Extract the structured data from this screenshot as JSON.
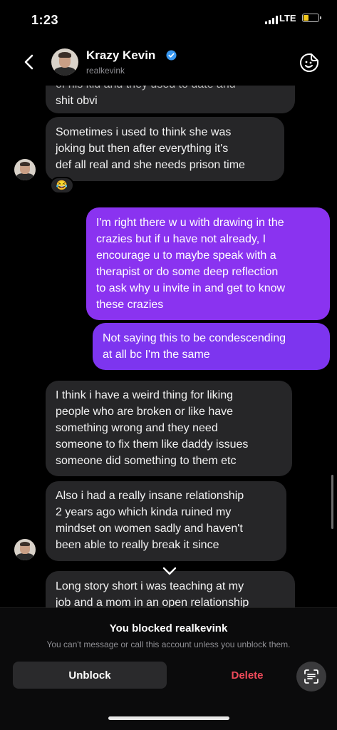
{
  "status_bar": {
    "time": "1:23",
    "network": "LTE",
    "battery_level": 0.25,
    "battery_color": "#f2c81e"
  },
  "header": {
    "name": "Krazy Kevin",
    "username": "realkevink",
    "verified_color": "#3897f0"
  },
  "messages": [
    {
      "side": "in",
      "lines": [
        "of his kid and they used to date and",
        "shit obvi"
      ]
    },
    {
      "side": "in",
      "lines": [
        "Sometimes i used to think she was",
        "joking but then after everything it's",
        "def all real and she needs prison time"
      ],
      "reaction": "😂"
    },
    {
      "side": "out",
      "lines": [
        "I'm right there w u with drawing in the",
        "crazies but if u have not already, I",
        "encourage u to maybe speak with a",
        "therapist or do some deep reflection",
        "to ask why u invite in and get to know",
        "these crazies"
      ]
    },
    {
      "side": "out",
      "lines": [
        "Not saying this to be condescending",
        "at all bc I'm the same"
      ]
    },
    {
      "side": "in",
      "lines": [
        "I think i have a weird thing for liking",
        "people who are broken or like have",
        "something wrong and they need",
        "someone to fix them like daddy issues",
        "someone did something to them etc"
      ]
    },
    {
      "side": "in",
      "lines": [
        "Also i had a really insane relationship",
        "2 years ago which kinda ruined my",
        "mindset on women sadly and haven't",
        "been able to really break it since"
      ]
    },
    {
      "side": "in",
      "lines": [
        "Long story short i was teaching at my",
        "job and a mom in an open relationship"
      ]
    }
  ],
  "footer": {
    "blocked_title": "You blocked realkevink",
    "blocked_subtitle": "You can't message or call this account unless you unblock them.",
    "unblock_label": "Unblock",
    "delete_label": "Delete"
  },
  "colors": {
    "outgoing": "#8a33f0",
    "incoming": "#262628",
    "delete": "#ef4a5a"
  },
  "icons": [
    "back-chevron-icon",
    "verified-badge-icon",
    "sticker-icon",
    "laugh-emoji-icon",
    "scroll-down-chevron-icon",
    "scan-text-icon"
  ]
}
